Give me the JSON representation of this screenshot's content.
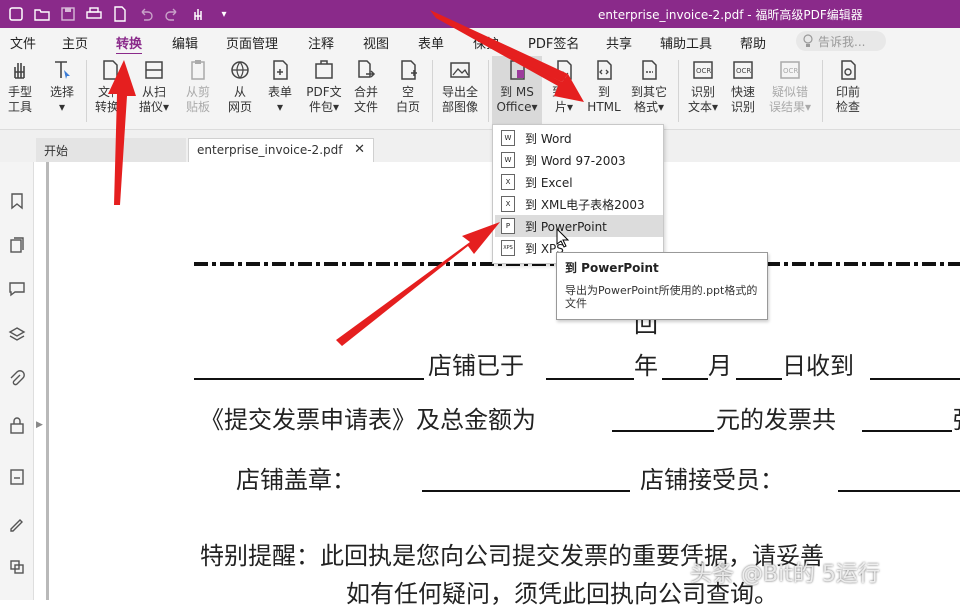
{
  "window": {
    "title": "enterprise_invoice-2.pdf - 福昕高级PDF编辑器",
    "quick_access_icons": [
      "open-file-icon",
      "folder-icon",
      "save-icon",
      "print-icon",
      "new-icon",
      "undo-icon",
      "redo-icon",
      "hand-icon",
      "customize-icon"
    ]
  },
  "menu": {
    "items": [
      {
        "label": "文件",
        "active": false
      },
      {
        "label": "主页",
        "active": false
      },
      {
        "label": "转换",
        "active": true
      },
      {
        "label": "编辑",
        "active": false
      },
      {
        "label": "页面管理",
        "active": false
      },
      {
        "label": "注释",
        "active": false
      },
      {
        "label": "视图",
        "active": false
      },
      {
        "label": "表单",
        "active": false
      },
      {
        "label": "保护",
        "active": false
      },
      {
        "label": "PDF签名",
        "active": false
      },
      {
        "label": "共享",
        "active": false
      },
      {
        "label": "辅助工具",
        "active": false
      },
      {
        "label": "帮助",
        "active": false
      }
    ],
    "search_placeholder": "告诉我..."
  },
  "ribbon": {
    "buttons": [
      {
        "id": "hand-tool",
        "label": "手型\n工具",
        "icon": "hand-icon",
        "disabled": false
      },
      {
        "id": "select",
        "label": "选择\n▾",
        "icon": "select-text-icon",
        "disabled": false
      },
      {
        "id": "file-convert",
        "label": "文件\n转换▾",
        "icon": "file-convert-icon",
        "disabled": false
      },
      {
        "id": "scanner",
        "label": "从扫\n描仪▾",
        "icon": "scanner-icon",
        "disabled": false
      },
      {
        "id": "clipboard",
        "label": "从剪\n贴板",
        "icon": "clipboard-icon",
        "disabled": true
      },
      {
        "id": "webpage",
        "label": "从\n网页",
        "icon": "globe-icon",
        "disabled": false
      },
      {
        "id": "form",
        "label": "表单\n▾",
        "icon": "form-icon",
        "disabled": false
      },
      {
        "id": "portfolio",
        "label": "PDF文\n件包▾",
        "icon": "portfolio-icon",
        "disabled": false
      },
      {
        "id": "combine",
        "label": "合并\n文件",
        "icon": "combine-icon",
        "disabled": false
      },
      {
        "id": "blank",
        "label": "空\n白页",
        "icon": "blank-page-icon",
        "disabled": false
      },
      {
        "id": "export-images",
        "label": "导出全\n部图像",
        "icon": "export-image-icon",
        "disabled": false
      },
      {
        "id": "to-ms-office",
        "label": "到 MS\nOffice▾",
        "icon": "ms-office-icon",
        "disabled": false
      },
      {
        "id": "to-image",
        "label": "到图\n片▾",
        "icon": "to-image-icon",
        "disabled": false
      },
      {
        "id": "to-html",
        "label": "到\nHTML",
        "icon": "html-icon",
        "disabled": false
      },
      {
        "id": "to-other",
        "label": "到其它\n格式▾",
        "icon": "other-format-icon",
        "disabled": false
      },
      {
        "id": "ocr-text",
        "label": "识别\n文本▾",
        "icon": "ocr-icon",
        "disabled": false
      },
      {
        "id": "quick-ocr",
        "label": "快速\n识别",
        "icon": "quick-ocr-icon",
        "disabled": false
      },
      {
        "id": "suspect-ocr",
        "label": "疑似错\n误结果▾",
        "icon": "suspect-ocr-icon",
        "disabled": true
      },
      {
        "id": "preflight",
        "label": "印前\n检查",
        "icon": "preflight-icon",
        "disabled": false
      }
    ]
  },
  "tabs": {
    "home": "开始",
    "document": "enterprise_invoice-2.pdf"
  },
  "sidebar": {
    "icons": [
      "bookmark-icon",
      "pages-icon",
      "comment-icon",
      "layers-icon",
      "attachment-icon",
      "security-icon",
      "fields-icon",
      "signature-icon",
      "content-icon"
    ]
  },
  "dropdown": {
    "items": [
      {
        "label": "到 Word",
        "icon": "W",
        "hover": false
      },
      {
        "label": "到 Word 97-2003",
        "icon": "W",
        "hover": false
      },
      {
        "label": "到 Excel",
        "icon": "X",
        "hover": false
      },
      {
        "label": "到 XML电子表格2003",
        "icon": "X",
        "hover": false
      },
      {
        "label": "到 PowerPoint",
        "icon": "P",
        "hover": true
      },
      {
        "label": "到 XPS",
        "icon": "XPS",
        "hover": false
      }
    ]
  },
  "tooltip": {
    "title": "到 PowerPoint",
    "description": "导出为PowerPoint所使用的.ppt格式的文件"
  },
  "document": {
    "heading_fragment": "回",
    "line1": [
      "店铺已于",
      "年",
      "月",
      "日收到"
    ],
    "line2_a": "《提交发票申请表》及总金额为",
    "line2_b": "元的发票共",
    "line2_c": "张",
    "line3_a": "店铺盖章：",
    "line3_b": "店铺接受员：",
    "line4": "特别提醒：此回执是您向公司提交发票的重要凭据，请妥善",
    "line5": "如有任何疑问，须凭此回执向公司查询。"
  },
  "watermark": "头条 @Bit的 5运行"
}
